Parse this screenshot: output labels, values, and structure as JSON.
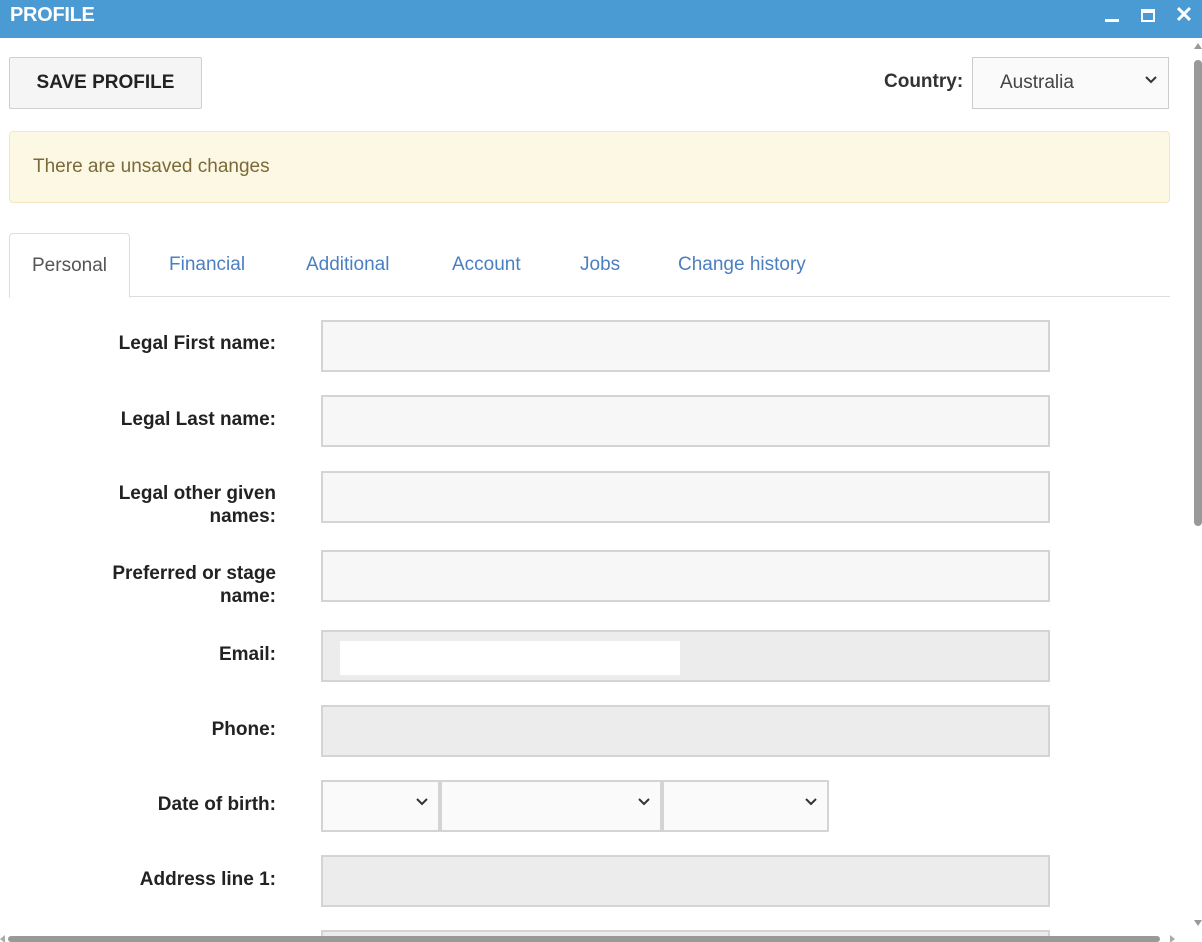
{
  "window": {
    "title": "PROFILE",
    "controls": {
      "minimize_icon": "minimize-icon",
      "maximize_icon": "maximize-icon",
      "close_glyph": "✕"
    }
  },
  "toolbar": {
    "save_label": "SAVE PROFILE",
    "country_label": "Country:",
    "country_value": "Australia"
  },
  "alert": {
    "message": "There are unsaved changes",
    "color": "#fcf8e3"
  },
  "tabs": [
    {
      "label": "Personal",
      "active": true
    },
    {
      "label": "Financial",
      "active": false
    },
    {
      "label": "Additional",
      "active": false
    },
    {
      "label": "Account",
      "active": false
    },
    {
      "label": "Jobs",
      "active": false
    },
    {
      "label": "Change history",
      "active": false
    }
  ],
  "form": {
    "first_name": {
      "label": "Legal First name:",
      "value": ""
    },
    "last_name": {
      "label": "Legal Last name:",
      "value": ""
    },
    "other_names": {
      "label_line1": "Legal other given",
      "label_line2": "names:",
      "value": ""
    },
    "preferred_name": {
      "label_line1": "Preferred or stage",
      "label_line2": "name:",
      "value": ""
    },
    "email": {
      "label": "Email:",
      "value": ""
    },
    "phone": {
      "label": "Phone:",
      "value": ""
    },
    "dob": {
      "label": "Date of birth:",
      "day": "",
      "month": "",
      "year": ""
    },
    "address1": {
      "label": "Address line 1:",
      "value": ""
    }
  },
  "colors": {
    "titlebar": "#4a9ad4",
    "tab_link": "#4a7fc1"
  }
}
